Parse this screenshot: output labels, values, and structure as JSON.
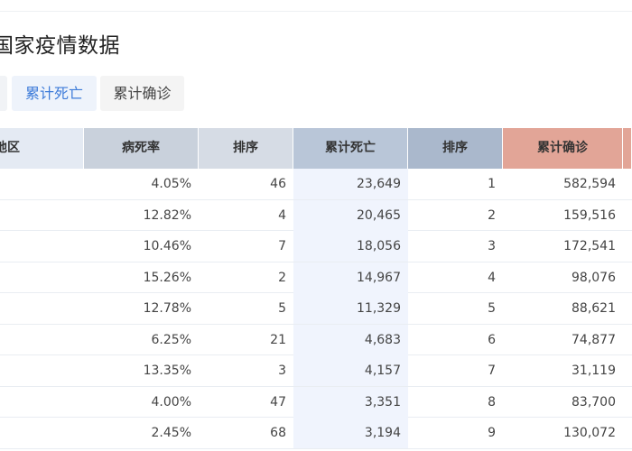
{
  "page": {
    "title": "国家疫情数据",
    "tabs": [
      {
        "label": ""
      },
      {
        "label": "累计死亡",
        "active": true
      },
      {
        "label": "累计确诊",
        "active": false
      }
    ]
  },
  "table": {
    "headers": {
      "region": "地区",
      "fatality_rate": "病死率",
      "rank_a": "排序",
      "total_deaths": "累计死亡",
      "rank_b": "排序",
      "total_cases": "累计确诊"
    },
    "rows": [
      {
        "fatality_rate": "4.05%",
        "rank_a": "46",
        "total_deaths": "23,649",
        "rank_b": "1",
        "total_cases": "582,594"
      },
      {
        "fatality_rate": "12.82%",
        "rank_a": "4",
        "total_deaths": "20,465",
        "rank_b": "2",
        "total_cases": "159,516"
      },
      {
        "fatality_rate": "10.46%",
        "rank_a": "7",
        "total_deaths": "18,056",
        "rank_b": "3",
        "total_cases": "172,541"
      },
      {
        "fatality_rate": "15.26%",
        "rank_a": "2",
        "total_deaths": "14,967",
        "rank_b": "4",
        "total_cases": "98,076"
      },
      {
        "fatality_rate": "12.78%",
        "rank_a": "5",
        "total_deaths": "11,329",
        "rank_b": "5",
        "total_cases": "88,621"
      },
      {
        "fatality_rate": "6.25%",
        "rank_a": "21",
        "total_deaths": "4,683",
        "rank_b": "6",
        "total_cases": "74,877"
      },
      {
        "fatality_rate": "13.35%",
        "rank_a": "3",
        "total_deaths": "4,157",
        "rank_b": "7",
        "total_cases": "31,119"
      },
      {
        "fatality_rate": "4.00%",
        "rank_a": "47",
        "total_deaths": "3,351",
        "rank_b": "8",
        "total_cases": "83,700"
      },
      {
        "fatality_rate": "2.45%",
        "rank_a": "68",
        "total_deaths": "3,194",
        "rank_b": "9",
        "total_cases": "130,072"
      }
    ]
  },
  "colors": {
    "active_tab_text": "#3d7bd9",
    "deaths_column_bg": "#f0f4fd",
    "cases_header_bg": "#e2a597"
  }
}
